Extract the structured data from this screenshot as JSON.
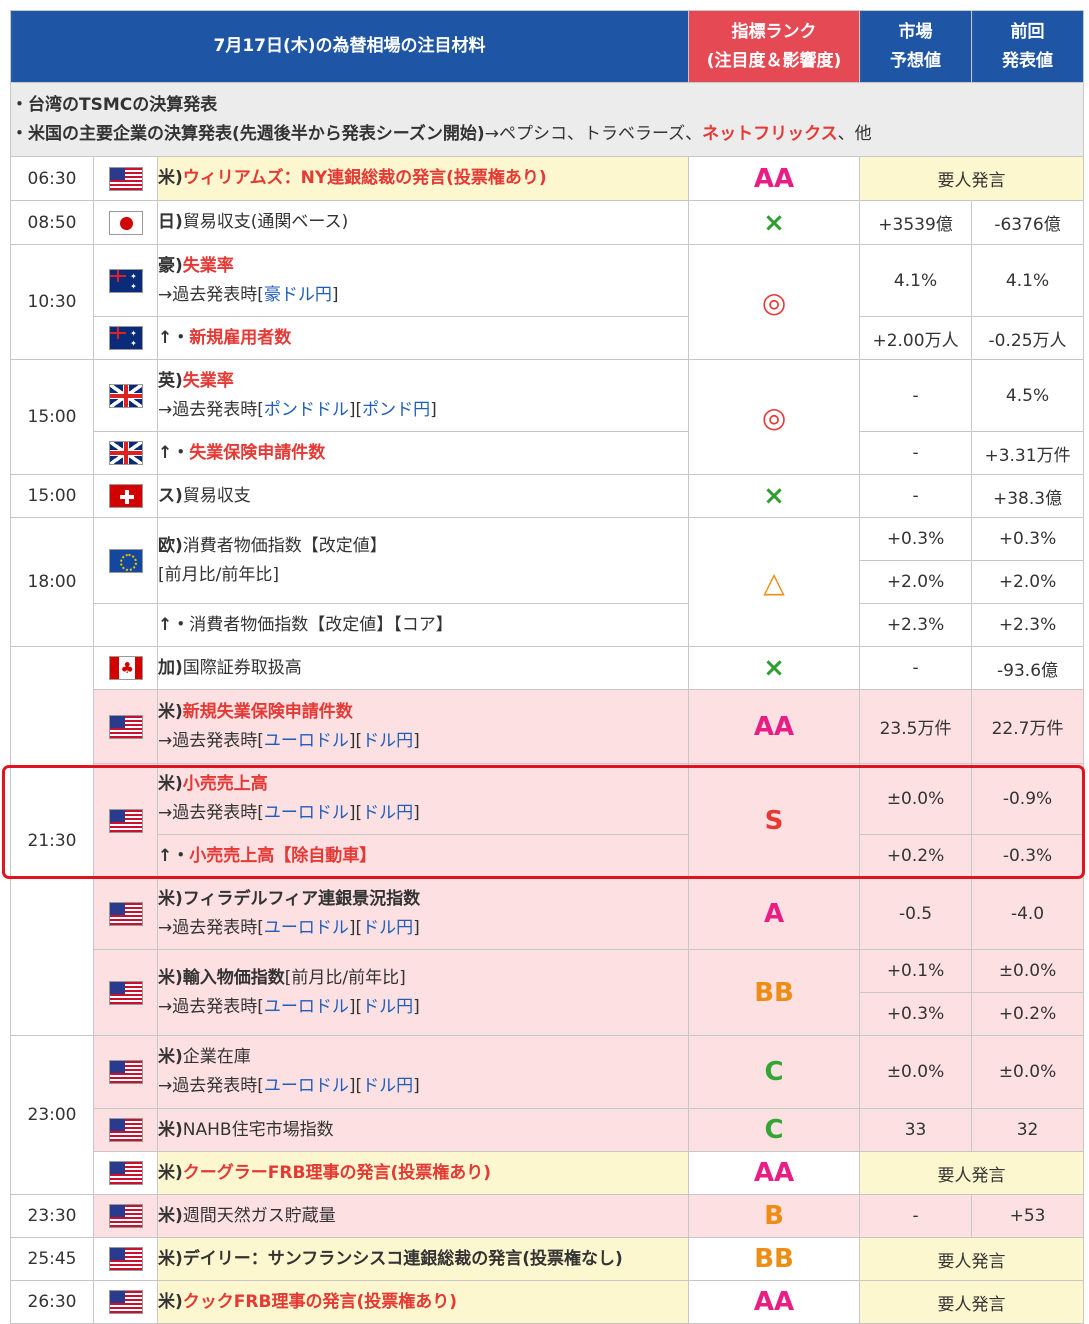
{
  "header": {
    "title": "7月17日(木)の為替相場の注目材料",
    "rank_line1": "指標ランク",
    "rank_line2": "(注目度＆影響度)",
    "forecast_line1": "市場",
    "forecast_line2": "予想値",
    "previous_line1": "前回",
    "previous_line2": "発表値"
  },
  "notes": {
    "line1": "・台湾のTSMCの決算発表",
    "line2_a": "・米国の主要企業の決算発表(先週後半から発表シーズン開始)",
    "line2_b": "→ペプシコ、トラベラーズ、",
    "line2_red": "ネットフリックス",
    "line2_c": "、他"
  },
  "past_prefix": "→過去発表時",
  "arrow_prefix": "↑・",
  "rows": [
    {
      "time": "06:30",
      "flag": "us-flag-icon",
      "country": "米)",
      "name": "ウィリアムズ：NY連銀総裁の発言(投票権あり)",
      "rank": "AA",
      "speech": "要人発言"
    },
    {
      "time": "08:50",
      "flag": "japan-flag-icon",
      "country": "日)",
      "name": "貿易収支(通関ベース)",
      "rank": "×",
      "forecast": "+3539億",
      "previous": "-6376億"
    },
    {
      "time": "10:30",
      "flag": "australia-flag-icon",
      "country": "豪)",
      "name": "失業率",
      "links": [
        "豪ドル円"
      ],
      "rank": "◎",
      "forecast": "4.1%",
      "previous": "4.1%",
      "sub_name": "新規雇用者数",
      "sub_forecast": "+2.00万人",
      "sub_previous": "-0.25万人"
    },
    {
      "time": "15:00",
      "flag": "uk-flag-icon",
      "country": "英)",
      "name": "失業率",
      "links": [
        "ポンドドル",
        "ポンド円"
      ],
      "rank": "◎",
      "forecast": "-",
      "previous": "4.5%",
      "sub_name": "失業保険申請件数",
      "sub_forecast": "-",
      "sub_previous": "+3.31万件"
    },
    {
      "time": "15:00",
      "flag": "swiss-flag-icon",
      "country": "ス)",
      "name": "貿易収支",
      "rank": "×",
      "forecast": "-",
      "previous": "+38.3億"
    },
    {
      "time": "18:00",
      "flag": "eu-flag-icon",
      "country": "欧)",
      "name": "消費者物価指数【改定値】",
      "bracket": "[前月比/前年比]",
      "rank": "△",
      "forecast_a": "+0.3%",
      "previous_a": "+0.3%",
      "forecast_b": "+2.0%",
      "previous_b": "+2.0%",
      "sub_name": "消費者物価指数【改定値】【コア】",
      "sub_forecast": "+2.3%",
      "sub_previous": "+2.3%"
    },
    {
      "time": "21:30",
      "flag": "canada-flag-icon",
      "country": "加)",
      "name": "国際証券取扱高",
      "rank": "×",
      "forecast": "-",
      "previous": "-93.6億"
    },
    {
      "flag": "us-flag-icon",
      "country": "米)",
      "name": "新規失業保険申請件数",
      "links": [
        "ユーロドル",
        "ドル円"
      ],
      "rank": "AA",
      "forecast": "23.5万件",
      "previous": "22.7万件"
    },
    {
      "flag": "us-flag-icon",
      "country": "米)",
      "name": "小売売上高",
      "links": [
        "ユーロドル",
        "ドル円"
      ],
      "rank": "S",
      "forecast": "±0.0%",
      "previous": "-0.9%",
      "sub_name": "小売売上高【除自動車】",
      "sub_forecast": "+0.2%",
      "sub_previous": "-0.3%"
    },
    {
      "flag": "us-flag-icon",
      "country": "米)",
      "name": "フィラデルフィア連銀景況指数",
      "links": [
        "ユーロドル",
        "ドル円"
      ],
      "rank": "A",
      "forecast": "-0.5",
      "previous": "-4.0"
    },
    {
      "flag": "us-flag-icon",
      "country": "米)",
      "name": "輸入物価指数",
      "bracket": "[前月比/前年比]",
      "links": [
        "ユーロドル",
        "ドル円"
      ],
      "rank": "BB",
      "forecast_a": "+0.1%",
      "previous_a": "±0.0%",
      "forecast_b": "+0.3%",
      "previous_b": "+0.2%"
    },
    {
      "time": "23:00",
      "flag": "us-flag-icon",
      "country": "米)",
      "name": "企業在庫",
      "links": [
        "ユーロドル",
        "ドル円"
      ],
      "rank": "C",
      "forecast": "±0.0%",
      "previous": "±0.0%"
    },
    {
      "flag": "us-flag-icon",
      "country": "米)",
      "name": "NAHB住宅市場指数",
      "rank": "C",
      "forecast": "33",
      "previous": "32"
    },
    {
      "flag": "us-flag-icon",
      "country": "米)",
      "name": "クーグラーFRB理事の発言(投票権あり)",
      "rank": "AA",
      "speech": "要人発言"
    },
    {
      "time": "23:30",
      "flag": "us-flag-icon",
      "country": "米)",
      "name": "週間天然ガス貯蔵量",
      "rank": "B",
      "forecast": "-",
      "previous": "+53"
    },
    {
      "time": "25:45",
      "flag": "us-flag-icon",
      "country": "米)",
      "name": "デイリー：サンフランシスコ連銀総裁の発言(投票権なし)",
      "rank": "BB",
      "speech": "要人発言"
    },
    {
      "time": "26:30",
      "flag": "us-flag-icon",
      "country": "米)",
      "name": "クックFRB理事の発言(投票権あり)",
      "rank": "AA",
      "speech": "要人発言"
    }
  ]
}
